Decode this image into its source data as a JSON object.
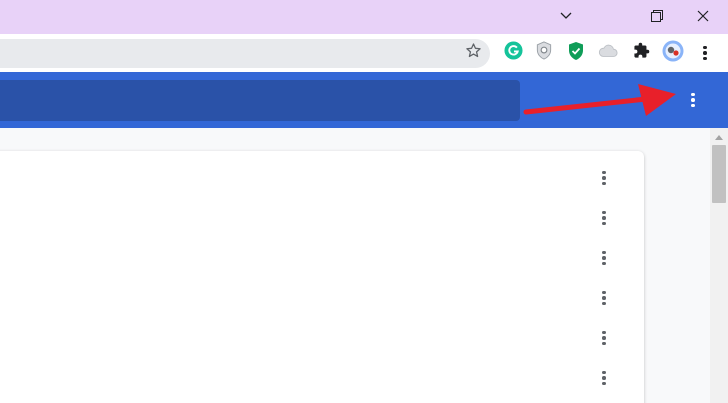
{
  "window": {
    "background_color": "#e8d2f8",
    "controls": [
      "chevron-down-icon",
      "restore-icon",
      "close-icon"
    ]
  },
  "toolbar": {
    "bookmark_icon": "star-icon",
    "extensions": [
      "grammarly-icon",
      "shield-extension-icon",
      "security-check-icon",
      "cloud-icon",
      "puzzle-icon",
      "profile-avatar"
    ],
    "menu_icon": "vertical-dots-icon"
  },
  "app": {
    "header_color": "#3367d6",
    "search_bar_color": "#2a52a8",
    "menu_icon": "vertical-dots-icon",
    "annotation": "red-arrow-pointing-to-menu",
    "annotation_color": "#e8202a"
  },
  "list": {
    "row_count": 6,
    "row_menu_icon": "vertical-dots-icon"
  }
}
